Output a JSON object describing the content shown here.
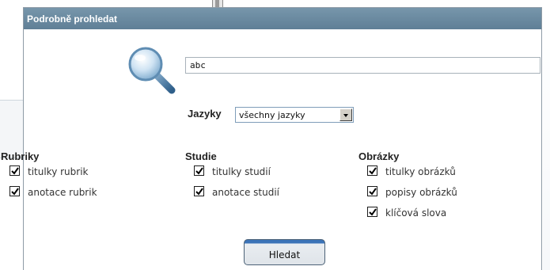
{
  "dialog": {
    "title": "Podrobně prohledat"
  },
  "search": {
    "value": "abc"
  },
  "language": {
    "label": "Jazyky",
    "selected": "všechny jazyky"
  },
  "columns": {
    "rubriky": {
      "heading": "Rubriky",
      "options": [
        "titulky rubrik",
        "anotace rubrik"
      ]
    },
    "studie": {
      "heading": "Studie",
      "options": [
        "titulky studií",
        "anotace studií"
      ]
    },
    "obrazky": {
      "heading": "Obrázky",
      "options": [
        "titulky obrázků",
        "popisy obrázků",
        "klíčová slova"
      ]
    }
  },
  "checked": [
    true,
    true,
    true,
    true,
    true,
    true,
    true
  ],
  "button": {
    "label": "Hledat"
  },
  "colors": {
    "titlebar": "#6b8aa0",
    "button_accent": "#3b73b8"
  }
}
